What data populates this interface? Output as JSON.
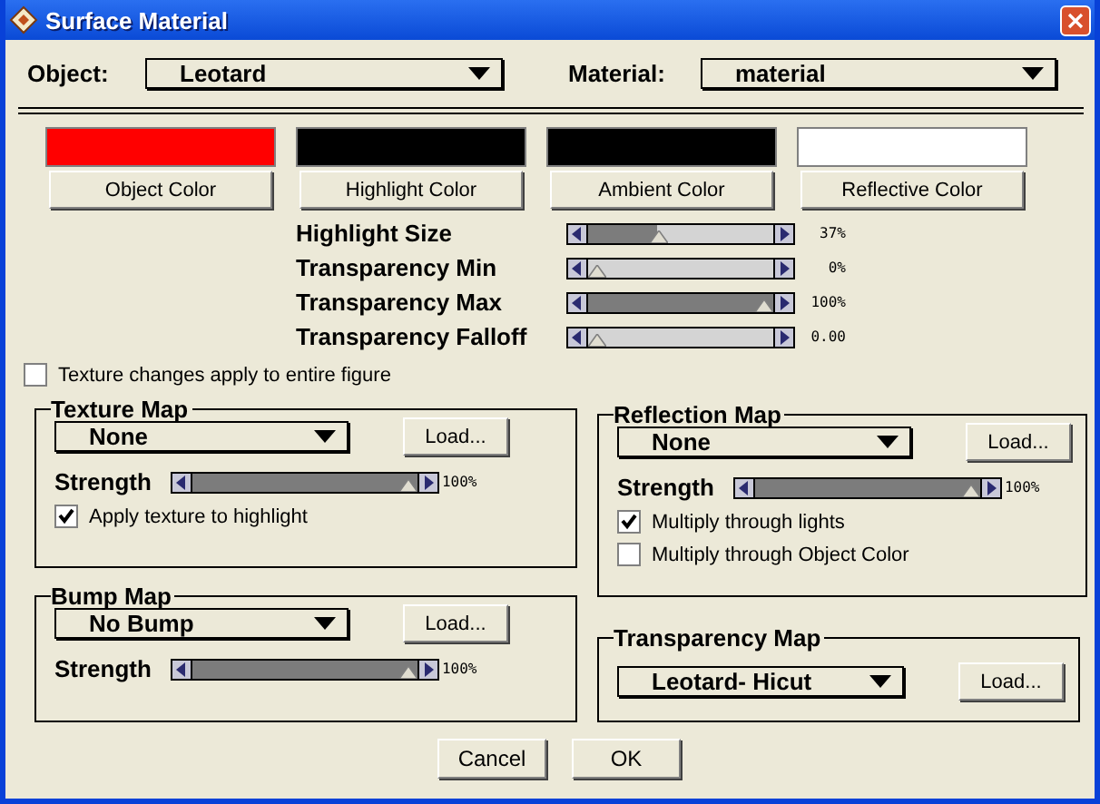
{
  "window": {
    "title": "Surface Material"
  },
  "object": {
    "label": "Object:",
    "value": "Leotard"
  },
  "material": {
    "label": "Material:",
    "value": "material"
  },
  "colors": [
    {
      "label": "Object Color",
      "color": "#ff0000"
    },
    {
      "label": "Highlight Color",
      "color": "#000000"
    },
    {
      "label": "Ambient Color",
      "color": "#000000"
    },
    {
      "label": "Reflective Color",
      "color": "#ffffff"
    }
  ],
  "sliders": [
    {
      "label": "Highlight Size",
      "level": 0.37,
      "reading": "37%"
    },
    {
      "label": "Transparency Min",
      "level": 0,
      "reading": "0%"
    },
    {
      "label": "Transparency Max",
      "level": 1,
      "reading": "100%"
    },
    {
      "label": "Transparency Falloff",
      "level": 0,
      "reading": "0.00"
    }
  ],
  "texture_all": {
    "label": "Texture changes apply to entire figure",
    "checked": false
  },
  "maps": [
    {
      "title": "Texture Map",
      "value": "None",
      "load": "Load...",
      "strength": {
        "label": "Strength",
        "level": 1,
        "reading": "100%"
      },
      "options": [
        {
          "label": "Apply texture to highlight",
          "checked": true
        }
      ]
    },
    {
      "title": "Bump Map",
      "value": "No Bump",
      "load": "Load...",
      "strength": {
        "label": "Strength",
        "level": 1,
        "reading": "100%"
      }
    },
    {
      "title": "Reflection Map",
      "value": "None",
      "load": "Load...",
      "strength": {
        "label": "Strength",
        "level": 1,
        "reading": "100%"
      },
      "options": [
        {
          "label": "Multiply through lights",
          "checked": true
        },
        {
          "label": "Multiply through Object Color",
          "checked": false
        }
      ]
    },
    {
      "title": "Transparency Map",
      "value": "Leotard- Hicut",
      "load": "Load..."
    }
  ],
  "buttons": [
    "Cancel",
    "OK"
  ]
}
